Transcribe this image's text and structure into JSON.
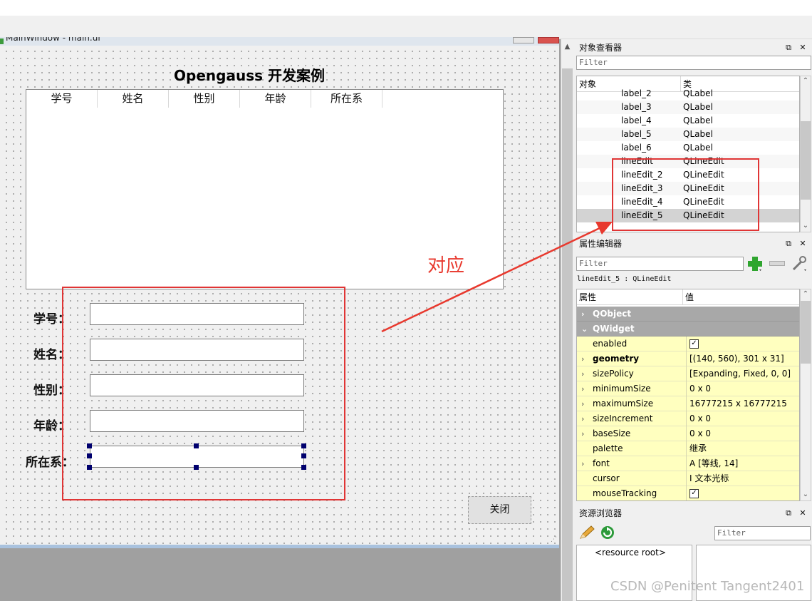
{
  "form_window": {
    "title": "MainWindow - main.ui",
    "heading": "Opengauss 开发案例",
    "table_headers": [
      "学号",
      "姓名",
      "性别",
      "年龄",
      "所在系"
    ],
    "fields": [
      {
        "label": "学号："
      },
      {
        "label": "姓名："
      },
      {
        "label": "性别："
      },
      {
        "label": "年龄："
      },
      {
        "label": "所在系："
      }
    ],
    "close_button": "关闭"
  },
  "annotation": {
    "text": "对应",
    "color": "#e8392e"
  },
  "object_inspector": {
    "title": "对象查看器",
    "filter_placeholder": "Filter",
    "col_object": "对象",
    "col_class": "类",
    "rows": [
      {
        "name": "label_2",
        "class": "QLabel"
      },
      {
        "name": "label_3",
        "class": "QLabel"
      },
      {
        "name": "label_4",
        "class": "QLabel"
      },
      {
        "name": "label_5",
        "class": "QLabel"
      },
      {
        "name": "label_6",
        "class": "QLabel"
      },
      {
        "name": "lineEdit",
        "class": "QLineEdit"
      },
      {
        "name": "lineEdit_2",
        "class": "QLineEdit"
      },
      {
        "name": "lineEdit_3",
        "class": "QLineEdit"
      },
      {
        "name": "lineEdit_4",
        "class": "QLineEdit"
      },
      {
        "name": "lineEdit_5",
        "class": "QLineEdit",
        "selected": true
      }
    ]
  },
  "property_editor": {
    "title": "属性编辑器",
    "filter_placeholder": "Filter",
    "object_label": "lineEdit_5 : QLineEdit",
    "col_property": "属性",
    "col_value": "值",
    "rows": [
      {
        "name": "QObject",
        "group": true,
        "expand": "›"
      },
      {
        "name": "QWidget",
        "group": true,
        "expand": "⌄"
      },
      {
        "name": "enabled",
        "value": "",
        "check": true,
        "expand": ""
      },
      {
        "name": "geometry",
        "value": "[(140, 560), 301 x 31]",
        "bold": true,
        "expand": "›"
      },
      {
        "name": "sizePolicy",
        "value": "[Expanding, Fixed, 0, 0]",
        "expand": "›"
      },
      {
        "name": "minimumSize",
        "value": "0 x 0",
        "expand": "›"
      },
      {
        "name": "maximumSize",
        "value": "16777215 x 16777215",
        "expand": "›"
      },
      {
        "name": "sizeIncrement",
        "value": "0 x 0",
        "expand": "›"
      },
      {
        "name": "baseSize",
        "value": "0 x 0",
        "expand": "›"
      },
      {
        "name": "palette",
        "value": "继承",
        "expand": ""
      },
      {
        "name": "font",
        "value": "A  [等线, 14]",
        "expand": "›"
      },
      {
        "name": "cursor",
        "value": "I   文本光标",
        "expand": ""
      },
      {
        "name": "mouseTracking",
        "value": "",
        "check": true,
        "expand": ""
      }
    ]
  },
  "resource_browser": {
    "title": "资源浏览器",
    "filter_placeholder": "Filter",
    "root_label": "<resource root>"
  },
  "dock_buttons": {
    "float": "⧉",
    "close": "✕"
  },
  "watermark": "CSDN @Penitent Tangent2401"
}
